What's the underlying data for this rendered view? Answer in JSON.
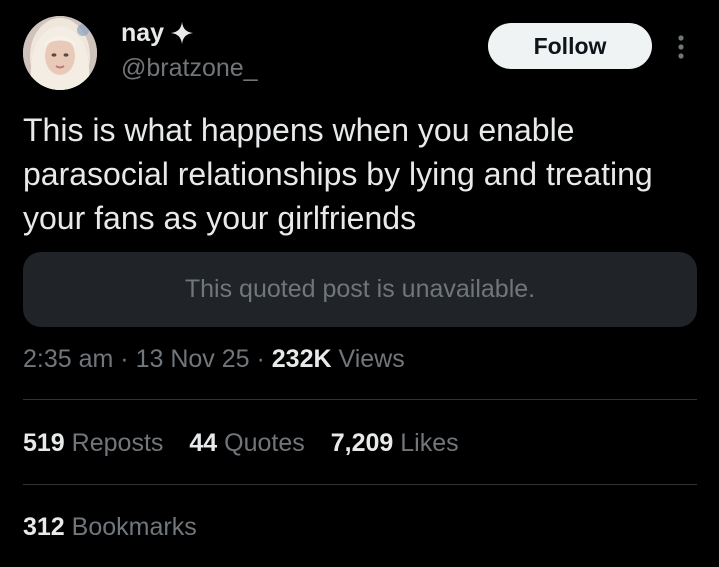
{
  "author": {
    "name": "nay",
    "handle": "@bratzone_",
    "badge_icon": "sparkle-icon",
    "avatar_icon": "profile-photo"
  },
  "actions": {
    "follow_label": "Follow",
    "more_icon": "more-vertical-icon"
  },
  "post": {
    "text": "This is what happens when you enable parasocial relationships by lying and treating your fans as your girlfriends",
    "quoted_post_notice": "This quoted post is unavailable."
  },
  "meta": {
    "time": "2:35 am",
    "separator": "·",
    "date": "13 Nov 25",
    "views_count": "232K",
    "views_label": "Views"
  },
  "stats": {
    "reposts_count": "519",
    "reposts_label": "Reposts",
    "quotes_count": "44",
    "quotes_label": "Quotes",
    "likes_count": "7,209",
    "likes_label": "Likes",
    "bookmarks_count": "312",
    "bookmarks_label": "Bookmarks"
  },
  "colors": {
    "background": "#000000",
    "primary_text": "#e7e9ea",
    "secondary_text": "#71767b",
    "follow_button_bg": "#eff3f4",
    "quote_box_bg": "#202327",
    "divider": "#2f3336"
  }
}
